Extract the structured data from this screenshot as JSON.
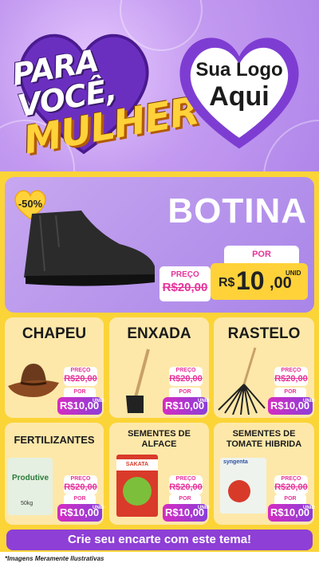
{
  "header": {
    "title_line1": "PARA VOCÊ,",
    "title_line2": "MULHER",
    "logo_line1": "Sua Logo",
    "logo_line2": "Aqui"
  },
  "featured": {
    "discount": "-50%",
    "name": "BOTINA",
    "old_label": "PREÇO",
    "old_price": "R$20,00",
    "por_label": "POR",
    "price_prefix": "R$",
    "price_main": "10",
    "price_cents": ",00",
    "unit": "UNID"
  },
  "products": [
    {
      "name": "CHAPEU",
      "old_label": "PREÇO",
      "old_price": "R$20,00",
      "por_label": "POR",
      "price": "R$10,00",
      "unit": "UNID"
    },
    {
      "name": "ENXADA",
      "old_label": "PREÇO",
      "old_price": "R$20,00",
      "por_label": "POR",
      "price": "R$10,00",
      "unit": "UNID"
    },
    {
      "name": "RASTELO",
      "old_label": "PREÇO",
      "old_price": "R$20,00",
      "por_label": "POR",
      "price": "R$10,00",
      "unit": "UNID"
    },
    {
      "name": "FERTILIZANTES",
      "old_label": "PREÇO",
      "old_price": "R$20,00",
      "por_label": "POR",
      "price": "R$10,00",
      "unit": "UNID",
      "pack_label": "Produtive",
      "pack_weight": "50kg"
    },
    {
      "name_l1": "SEMENTES DE",
      "name_l2": "ALFACE",
      "old_label": "PREÇO",
      "old_price": "R$20,00",
      "por_label": "POR",
      "price": "R$10,00",
      "unit": "UNID",
      "pack_label": "SAKATA"
    },
    {
      "name_l1": "SEMENTES DE",
      "name_l2": "TOMATE HIBRIDA",
      "old_label": "PREÇO",
      "old_price": "R$20,00",
      "por_label": "POR",
      "price": "R$10,00",
      "unit": "UNID",
      "pack_label": "syngenta"
    }
  ],
  "footer": {
    "cta": "Crie seu encarte com este tema!",
    "disclaimer": "*Imagens Meramente Ilustrativas"
  },
  "colors": {
    "purple": "#8e3fd6",
    "yellow": "#fbd437",
    "pink": "#e6339a",
    "cream": "#fde8a9"
  }
}
